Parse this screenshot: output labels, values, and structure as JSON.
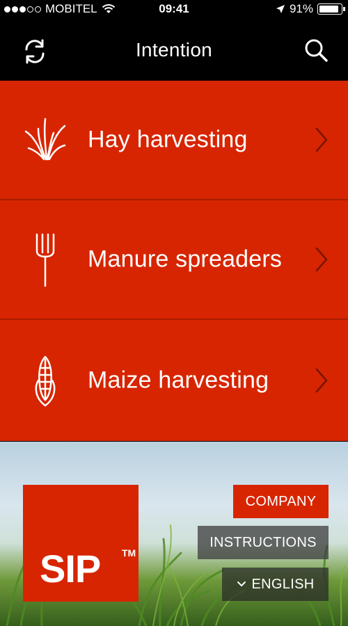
{
  "status_bar": {
    "carrier": "MOBITEL",
    "time": "09:41",
    "battery_percent": "91%",
    "battery_level": 0.91,
    "signal_bars_filled": 3,
    "signal_bars_total": 5
  },
  "nav": {
    "title": "Intention",
    "left_icon": "refresh-icon",
    "right_icon": "search-icon"
  },
  "menu": {
    "items": [
      {
        "label": "Hay harvesting",
        "icon": "grass-icon"
      },
      {
        "label": "Manure spreaders",
        "icon": "pitchfork-icon"
      },
      {
        "label": "Maize harvesting",
        "icon": "corn-icon"
      }
    ]
  },
  "footer": {
    "logo_text": "SIP",
    "logo_tm": "TM",
    "company_label": "COMPANY",
    "instructions_label": "INSTRUCTIONS",
    "language_label": "ENGLISH"
  },
  "colors": {
    "brand_red": "#d72501",
    "divider_red": "#a81d02",
    "nav_background": "#000000"
  }
}
